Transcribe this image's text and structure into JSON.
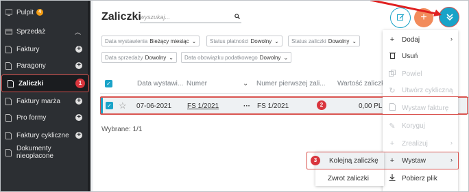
{
  "sidebar": {
    "items": [
      {
        "label": "Pulpit",
        "badge": "4",
        "icon": "dashboard-icon"
      },
      {
        "label": "Sprzedaż",
        "icon": "sales-icon"
      },
      {
        "label": "Faktury",
        "icon": "document-icon"
      },
      {
        "label": "Paragony",
        "icon": "document-icon"
      },
      {
        "label": "Zaliczki",
        "icon": "document-icon",
        "step": "1"
      },
      {
        "label": "Faktury marża",
        "icon": "document-icon"
      },
      {
        "label": "Pro formy",
        "icon": "document-icon"
      },
      {
        "label": "Faktury cykliczne",
        "icon": "document-icon"
      },
      {
        "label": "Dokumenty nieopłacone",
        "icon": "document-icon"
      }
    ]
  },
  "header": {
    "title": "Zaliczki",
    "search_placeholder": "wyszukaj..."
  },
  "filters": [
    {
      "label": "Data wystawienia",
      "value": "Bieżący miesiąc"
    },
    {
      "label": "Status płatności",
      "value": "Dowolny"
    },
    {
      "label": "Status zaliczki",
      "value": "Dowolny"
    },
    {
      "label": "Data sprzedaży",
      "value": "Dowolny"
    },
    {
      "label": "Data obowiązku podatkowego",
      "value": "Dowolny"
    }
  ],
  "table": {
    "columns": [
      "Data wystawi...",
      "Numer",
      "Numer pierwszej zali...",
      "Wartość zaliczki"
    ],
    "rows": [
      {
        "date": "07-06-2021",
        "number": "FS 1/2021",
        "dots": "···",
        "first_number": "FS 1/2021",
        "value": "0,00 PLN",
        "step": "2"
      }
    ],
    "selected_text": "Wybrane: 1/1"
  },
  "menu": {
    "items": [
      {
        "label": "Dodaj",
        "icon": "plus-icon",
        "disabled": false,
        "arrow": "›"
      },
      {
        "label": "Usuń",
        "icon": "trash-icon",
        "disabled": false
      },
      {
        "label": "Powiel",
        "icon": "copy-icon",
        "disabled": true
      },
      {
        "label": "Utwórz cykliczną",
        "icon": "cycle-icon",
        "disabled": true
      },
      {
        "label": "Wystaw fakturę",
        "icon": "invoice-icon",
        "disabled": true
      },
      {
        "label": "Koryguj",
        "icon": "wrench-icon",
        "disabled": true
      },
      {
        "label": "Zrealizuj",
        "icon": "plus-icon",
        "disabled": true,
        "arrow": "›"
      },
      {
        "label": "Wystaw",
        "icon": "plus-icon",
        "disabled": false,
        "arrow": "›"
      },
      {
        "label": "Pobierz plik",
        "icon": "download-icon",
        "disabled": false
      }
    ]
  },
  "submenu": {
    "items": [
      {
        "label": "Kolejną zaliczkę",
        "step": "3"
      },
      {
        "label": "Zwrot zaliczki"
      }
    ]
  },
  "colors": {
    "accent": "#1aa3c8",
    "orange": "#f28b5b",
    "red": "#d9363e"
  }
}
